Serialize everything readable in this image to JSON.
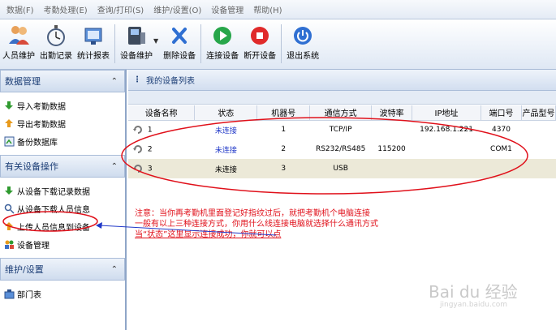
{
  "menu": [
    "数据(F)",
    "考勤处理(E)",
    "查询/打印(S)",
    "维护/设置(O)",
    "设备管理",
    "帮助(H)"
  ],
  "toolbar": {
    "staff": "人员维护",
    "records": "出勤记录",
    "stats": "统计报表",
    "device_maint": "设备维护",
    "delete_device": "删除设备",
    "connect": "连接设备",
    "disconnect": "断开设备",
    "exit": "退出系统"
  },
  "sidebar": {
    "data_mgmt": {
      "title": "数据管理",
      "items": [
        "导入考勤数据",
        "导出考勤数据",
        "备份数据库"
      ]
    },
    "device_ops": {
      "title": "有关设备操作",
      "items": [
        "从设备下载记录数据",
        "从设备下载人员信息",
        "上传人员信息到设备",
        "设备管理"
      ]
    },
    "maint": {
      "title": "维护/设置",
      "items": [
        "部门表"
      ]
    }
  },
  "device_panel": {
    "title": "我的设备列表",
    "columns": [
      "设备名称",
      "状态",
      "机器号",
      "通信方式",
      "波特率",
      "IP地址",
      "端口号",
      "产品型号"
    ],
    "rows": [
      {
        "name": "1",
        "status": "未连接",
        "machine_no": "1",
        "comm": "TCP/IP",
        "baud": "",
        "ip": "192.168.1.221",
        "port": "4370",
        "model": ""
      },
      {
        "name": "2",
        "status": "未连接",
        "machine_no": "2",
        "comm": "RS232/RS485",
        "baud": "115200",
        "ip": "",
        "port": "COM1",
        "model": ""
      },
      {
        "name": "3",
        "status": "未连接",
        "machine_no": "3",
        "comm": "USB",
        "baud": "",
        "ip": "",
        "port": "",
        "model": ""
      }
    ],
    "notes": [
      "注意：当你再考勤机里面登记好指纹过后，就把考勤机个电脑连接",
      "一般有以上三种连接方式，你用什么线连接电脑就选择什么通讯方式",
      "当“状态”这里显示连接成功，你就可以点"
    ]
  },
  "watermark": {
    "brand": "Bai du 经验",
    "url": "jingyan.baidu.com"
  },
  "colors": {
    "annotation": "#e0101a",
    "status": "#2038c8",
    "header_text": "#1b3d75"
  }
}
